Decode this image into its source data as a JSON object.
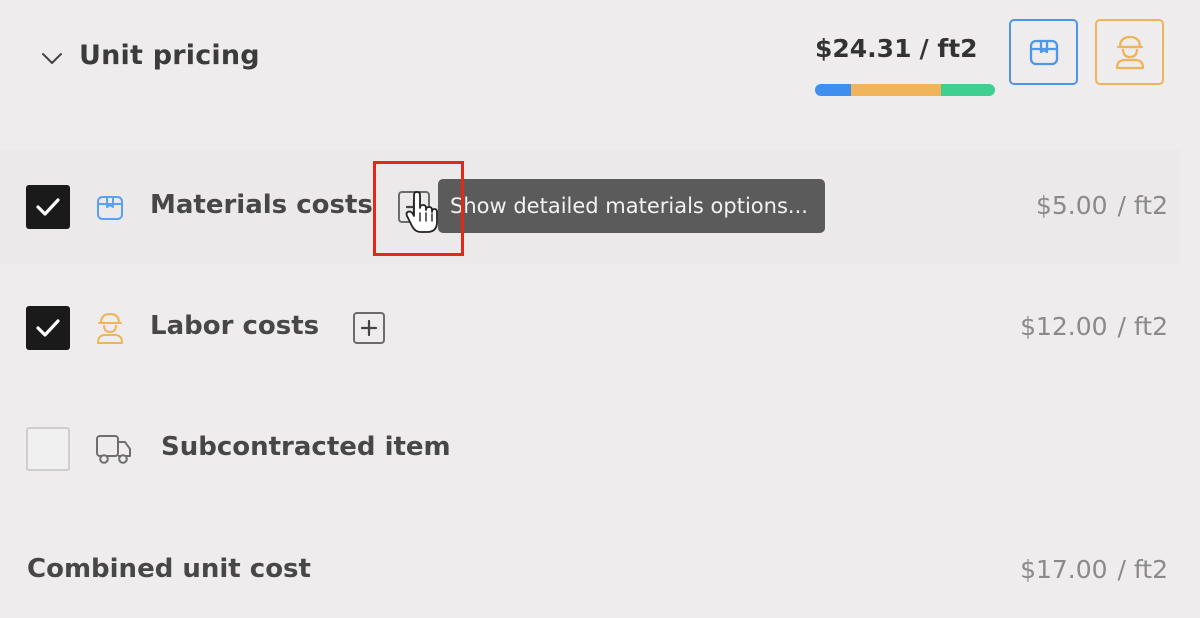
{
  "header": {
    "title": "Unit pricing",
    "total_price": "$24.31",
    "total_unit": "/ ft2",
    "cost_breakdown_bar": [
      {
        "name": "materials",
        "color": "#3f8ff0",
        "share": 0.2
      },
      {
        "name": "labor",
        "color": "#f0b55a",
        "share": 0.5
      },
      {
        "name": "other",
        "color": "#3ecf91",
        "share": 0.3
      }
    ],
    "buttons": {
      "materials": {
        "icon": "box-icon",
        "color": "#4e96ea"
      },
      "labor": {
        "icon": "worker-icon",
        "color": "#f0b35b"
      }
    }
  },
  "rows": [
    {
      "key": "materials",
      "label": "Materials costs",
      "checked": true,
      "icon": "box-icon",
      "icon_color": "#5aa2ef",
      "price": "$5.00",
      "unit": "/ ft2"
    },
    {
      "key": "labor",
      "label": "Labor costs",
      "checked": true,
      "icon": "worker-icon",
      "icon_color": "#f0b35b",
      "price": "$12.00",
      "unit": "/ ft2"
    },
    {
      "key": "subcontracted",
      "label": "Subcontracted item",
      "checked": false,
      "icon": "truck-icon",
      "icon_color": "#6e6e6e"
    }
  ],
  "tooltip": {
    "text": "Show detailed materials options..."
  },
  "combined": {
    "label": "Combined unit cost",
    "price": "$17.00",
    "unit": "/ ft2"
  }
}
